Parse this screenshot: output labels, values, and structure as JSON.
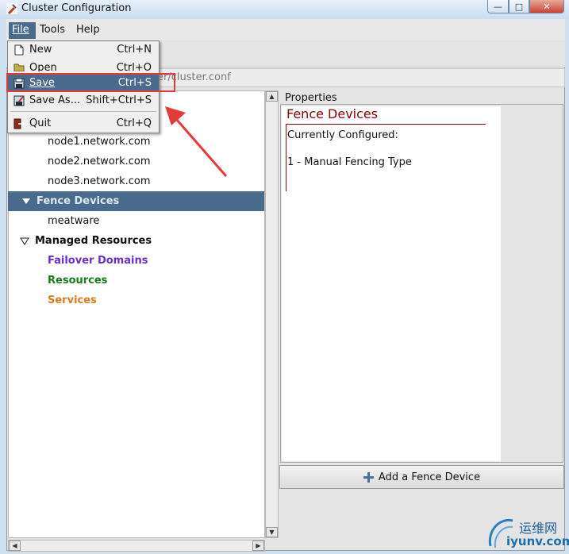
{
  "window": {
    "title": "Cluster Configuration"
  },
  "menubar": {
    "file": "File",
    "tools": "Tools",
    "help": "Help"
  },
  "path": "er/cluster.conf",
  "file_menu": {
    "items": [
      {
        "label": "New",
        "shortcut": "Ctrl+N",
        "icon": "new-file-icon"
      },
      {
        "label": "Open",
        "shortcut": "Ctrl+O",
        "icon": "open-folder-icon"
      },
      {
        "label": "Save",
        "shortcut": "Ctrl+S",
        "icon": "save-icon",
        "highlighted": true
      },
      {
        "label": "Save As...",
        "shortcut": "Shift+Ctrl+S",
        "icon": "save-as-icon"
      },
      {
        "label": "Quit",
        "shortcut": "Ctrl+Q",
        "icon": "quit-icon"
      }
    ]
  },
  "tree": {
    "nodes": [
      "node1.network.com",
      "node2.network.com",
      "node3.network.com"
    ],
    "fence_devices": "Fence Devices",
    "meatware": "meatware",
    "managed_resources": "Managed Resources",
    "failover_domains": "Failover Domains",
    "resources": "Resources",
    "services": "Services"
  },
  "colors": {
    "failover": "#6a2fc8",
    "resources": "#1a7a1a",
    "services": "#e07a1a",
    "selection": "#4a6b8c",
    "fence_title": "#8b0000",
    "annotation": "#e43a3a"
  },
  "properties": {
    "label": "Properties",
    "title": "Fence Devices",
    "currently": "Currently Configured:",
    "item": "1 - Manual Fencing Type"
  },
  "add_button": "Add a Fence Device",
  "watermark": {
    "cn": "运维网",
    "url": "iyunv.com"
  }
}
